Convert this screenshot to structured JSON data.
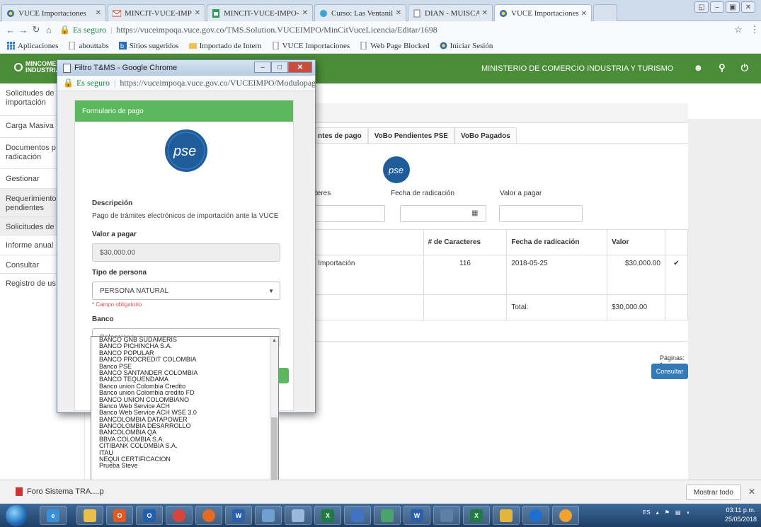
{
  "browser": {
    "tabs": [
      {
        "label": "VUCE Importaciones"
      },
      {
        "label": "MINCIT-VUCE-IMPO-Seg"
      },
      {
        "label": "MINCIT-VUCE-IMPO-Seg"
      },
      {
        "label": "Curso: Las Ventanillas Ún"
      },
      {
        "label": "DIAN - MUISCA"
      },
      {
        "label": "VUCE Importaciones"
      }
    ],
    "secure_label": "Es seguro",
    "url": "https://vuceimpoqa.vuce.gov.co/TMS.Solution.VUCEIMPO/MinCitVuceLicencia/Editar/1698",
    "bookmarks": [
      "Aplicaciones",
      "abouttabs",
      "Sitios sugeridos",
      "Importado de Intern",
      "VUCE Importaciones",
      "Web Page Blocked",
      "Iniciar Sesión"
    ]
  },
  "header": {
    "logo_line1": "MINCOME",
    "logo_line2": "INDUSTRIA",
    "ministry": "MINISTERIO DE COMERCIO INDUSTRIA Y TURISMO"
  },
  "sidebar": {
    "items": [
      {
        "label": "Solicitudes de importación"
      },
      {
        "label": "Carga Masiva"
      },
      {
        "label": "Documentos p radicación"
      },
      {
        "label": "Gestionar"
      },
      {
        "label": "Requerimiento pendientes"
      },
      {
        "label": "Solicitudes de"
      },
      {
        "label": "Informe anual"
      },
      {
        "label": "Consultar"
      },
      {
        "label": "Registro de us"
      }
    ]
  },
  "main": {
    "tabs": [
      "ntes de pago",
      "VoBo Pendientes PSE",
      "VoBo Pagados"
    ],
    "pse_label": "pse",
    "filters": {
      "caracteres": "cteres",
      "fecha_radicacion": "Fecha de radicación",
      "valor_pagar": "Valor a pagar"
    },
    "table": {
      "headers": [
        "",
        "# de Caracteres",
        "Fecha de radicación",
        "Valor",
        ""
      ],
      "row": {
        "desc": "a de Importación",
        "chars": "116",
        "date": "2018-05-25",
        "value": "$30,000.00",
        "checked": "✔"
      },
      "total_label": "Total:",
      "total_value": "$30,000.00"
    },
    "paginas": "Páginas: 1",
    "consultar": "Consultar"
  },
  "popup": {
    "title": "Filtro T&MS - Google Chrome",
    "secure_label": "Es seguro",
    "url": "https://vuceimpoqa.vuce.gov.co/VUCEIMPO/Modulopago/asp...",
    "card_title": "Formulario de pago",
    "pse_label": "pse",
    "descripcion_label": "Descripción",
    "descripcion_text": "Pago de trámites electrónicos de importación ante la VUCE",
    "valor_label": "Valor a pagar",
    "valor_value": "$30,000.00",
    "tipo_label": "Tipo de persona",
    "tipo_value": "PERSONA NATURAL",
    "campo_obligatorio": "* Campo obligatorio",
    "banco_label": "Banco",
    "banco_placeholder": "Seleccione..",
    "banco_options": [
      "BANCO GNB SUDAMERIS",
      "BANCO PICHINCHA S.A.",
      "BANCO POPULAR",
      "BANCO PROCREDIT COLOMBIA",
      "Banco PSE",
      "BANCO SANTANDER COLOMBIA",
      "BANCO TEQUENDAMA",
      "Banco union Colombia Credito",
      "Banco union Colombia credito FD",
      "BANCO UNION COLOMBIANO",
      "Banco Web Service ACH",
      "Banco Web Service ACH WSE 3.0",
      "BANCOLOMBIA DATAPOWER",
      "BANCOLOMBIA DESARROLLO",
      "BANCOLOMBIA QA",
      "BBVA COLOMBIA S.A.",
      "CITIBANK COLOMBIA S.A.",
      "ITAU",
      "NEQUI CERTIFICACION",
      "Prueba Steve"
    ]
  },
  "downloads": {
    "item": "Foro Sistema TRA....p",
    "show_all": "Mostrar todo"
  },
  "taskbar": {
    "lang": "ES",
    "time": "03:11 p.m.",
    "date": "25/05/2018"
  },
  "colors": {
    "green": "#4a8c37",
    "card_green": "#5cb85c",
    "button_blue": "#337ab7"
  }
}
